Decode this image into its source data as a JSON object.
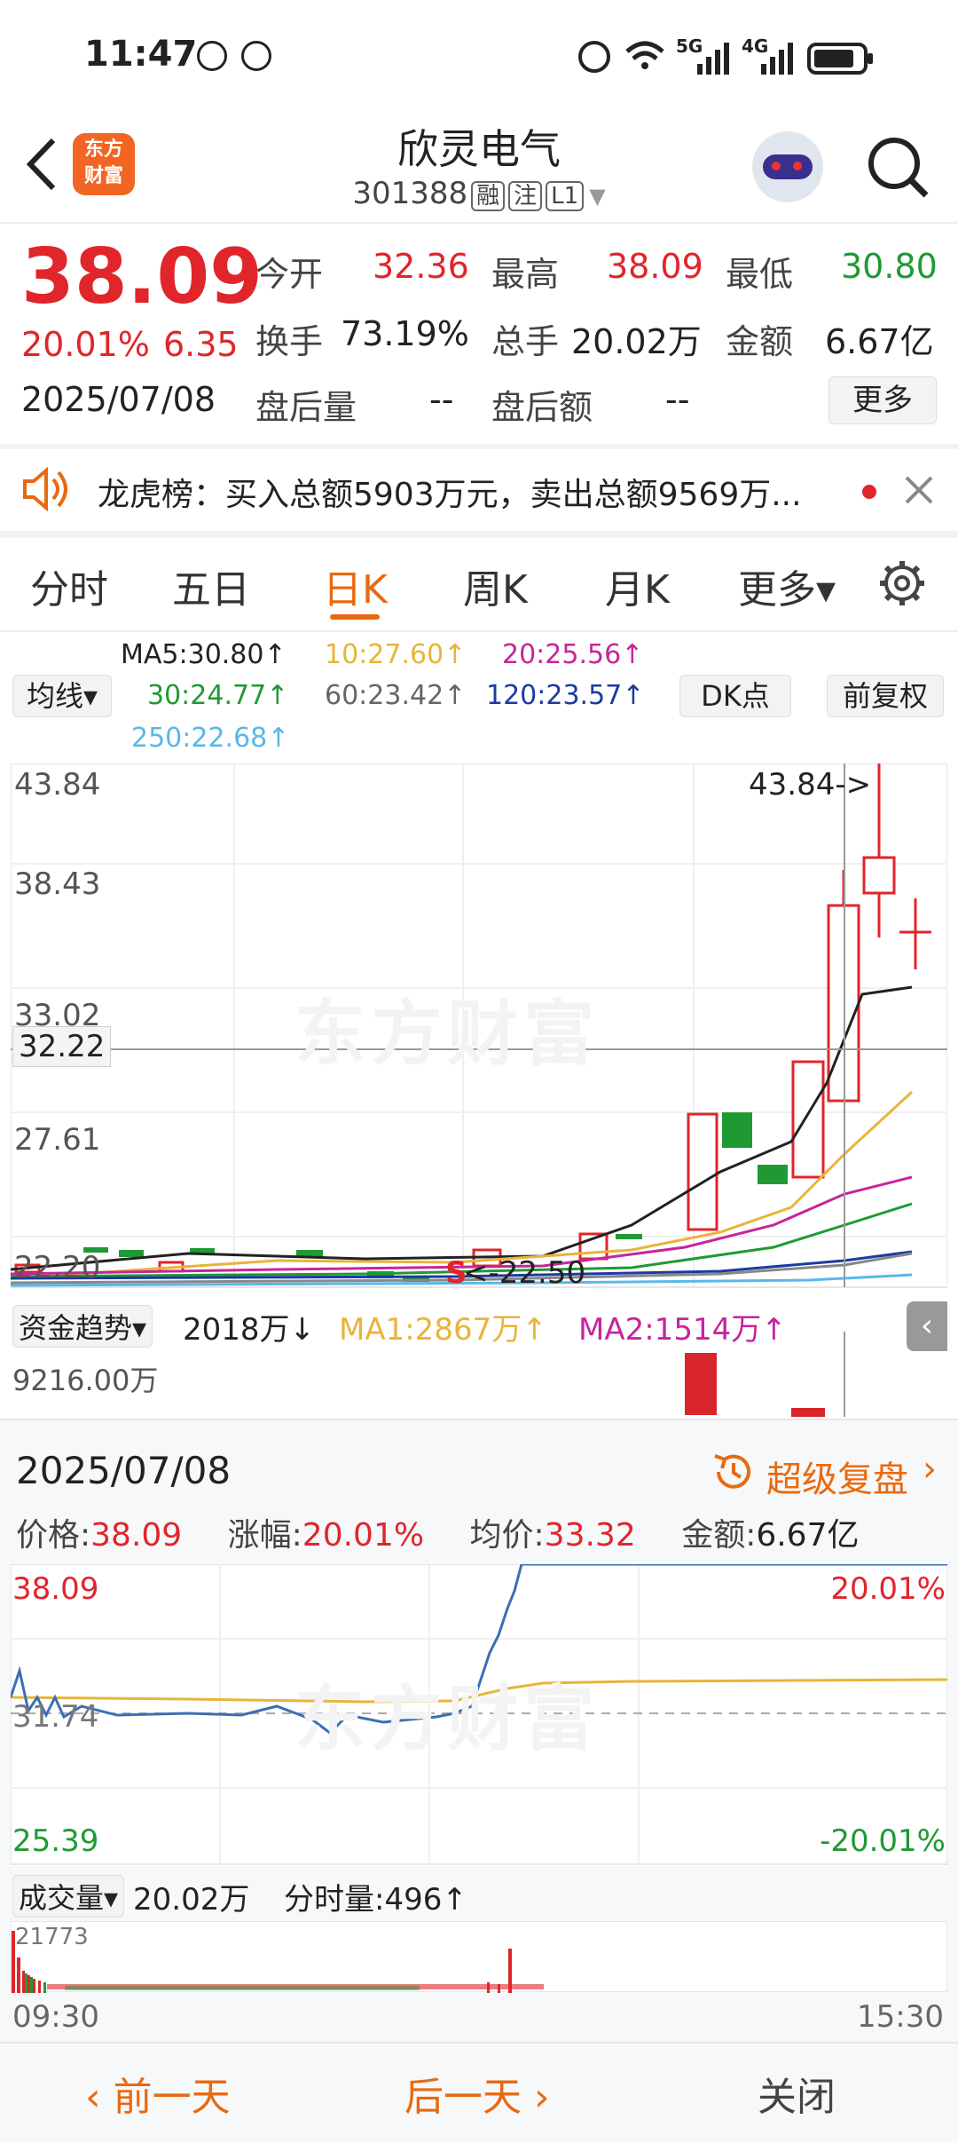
{
  "status": {
    "time": "11:47",
    "network5g": "5G",
    "network4g": "4G"
  },
  "header": {
    "logo_text": "东方\n财富",
    "stock_name": "欣灵电气",
    "stock_code": "301388",
    "badges": [
      "融",
      "注",
      "L1"
    ]
  },
  "quote": {
    "price": "38.09",
    "change_pct": "20.01%",
    "change": "6.35",
    "date": "2025/07/08",
    "open_label": "今开",
    "open": "32.36",
    "high_label": "最高",
    "high": "38.09",
    "low_label": "最低",
    "low": "30.80",
    "turnover_label": "换手",
    "turnover": "73.19%",
    "volume_label": "总手",
    "volume": "20.02万",
    "amount_label": "金额",
    "amount": "6.67亿",
    "after_vol_label": "盘后量",
    "after_vol": "--",
    "after_amt_label": "盘后额",
    "after_amt": "--",
    "more_button": "更多"
  },
  "notice": {
    "text": "龙虎榜：买入总额5903万元，卖出总额9569万..."
  },
  "tabs": [
    "分时",
    "五日",
    "日K",
    "周K",
    "月K",
    "更多▾"
  ],
  "ma": {
    "selector": "均线▾",
    "ma5": "MA5:30.80↑",
    "ma10": "10:27.60↑",
    "ma20": "20:25.56↑",
    "ma30": "30:24.77↑",
    "ma60": "60:23.42↑",
    "ma120": "120:23.57↑",
    "ma250": "250:22.68↑",
    "dk_button": "DK点",
    "adjust_button": "前复权",
    "colors": {
      "ma5": "#222222",
      "ma10": "#e8b43a",
      "ma20": "#c8249a",
      "ma30": "#1f9a33",
      "ma60": "#777777",
      "ma120": "#1c3aa0",
      "ma250": "#58b8e8"
    }
  },
  "kchart": {
    "y_labels": [
      "43.84",
      "38.43",
      "33.02",
      "27.61",
      "22.20"
    ],
    "cursor_price": "32.22",
    "high_marker": "43.84->",
    "low_marker": "<-22.50",
    "watermark": "东方财富"
  },
  "fund": {
    "selector": "资金趋势▾",
    "value": "2018万↓",
    "ma1": "MA1:2867万↑",
    "ma2": "MA2:1514万↑",
    "scale": "9216.00万"
  },
  "panel": {
    "date": "2025/07/08",
    "replay": "超级复盘",
    "price_label": "价格:",
    "price": "38.09",
    "chg_label": "涨幅:",
    "chg": "20.01%",
    "avg_label": "均价:",
    "avg": "33.32",
    "amt_label": "金额:",
    "amt": "6.67亿"
  },
  "intraday": {
    "top_price": "38.09",
    "top_pct": "20.01%",
    "mid_price": "31.74",
    "bottom_price": "25.39",
    "bottom_pct": "-20.01%"
  },
  "volume": {
    "selector": "成交量▾",
    "total": "20.02万",
    "minute_label": "分时量:496↑",
    "scale": "21773",
    "start_time": "09:30",
    "end_time": "15:30"
  },
  "footer": {
    "prev": "前一天",
    "next": "后一天",
    "close": "关闭"
  }
}
